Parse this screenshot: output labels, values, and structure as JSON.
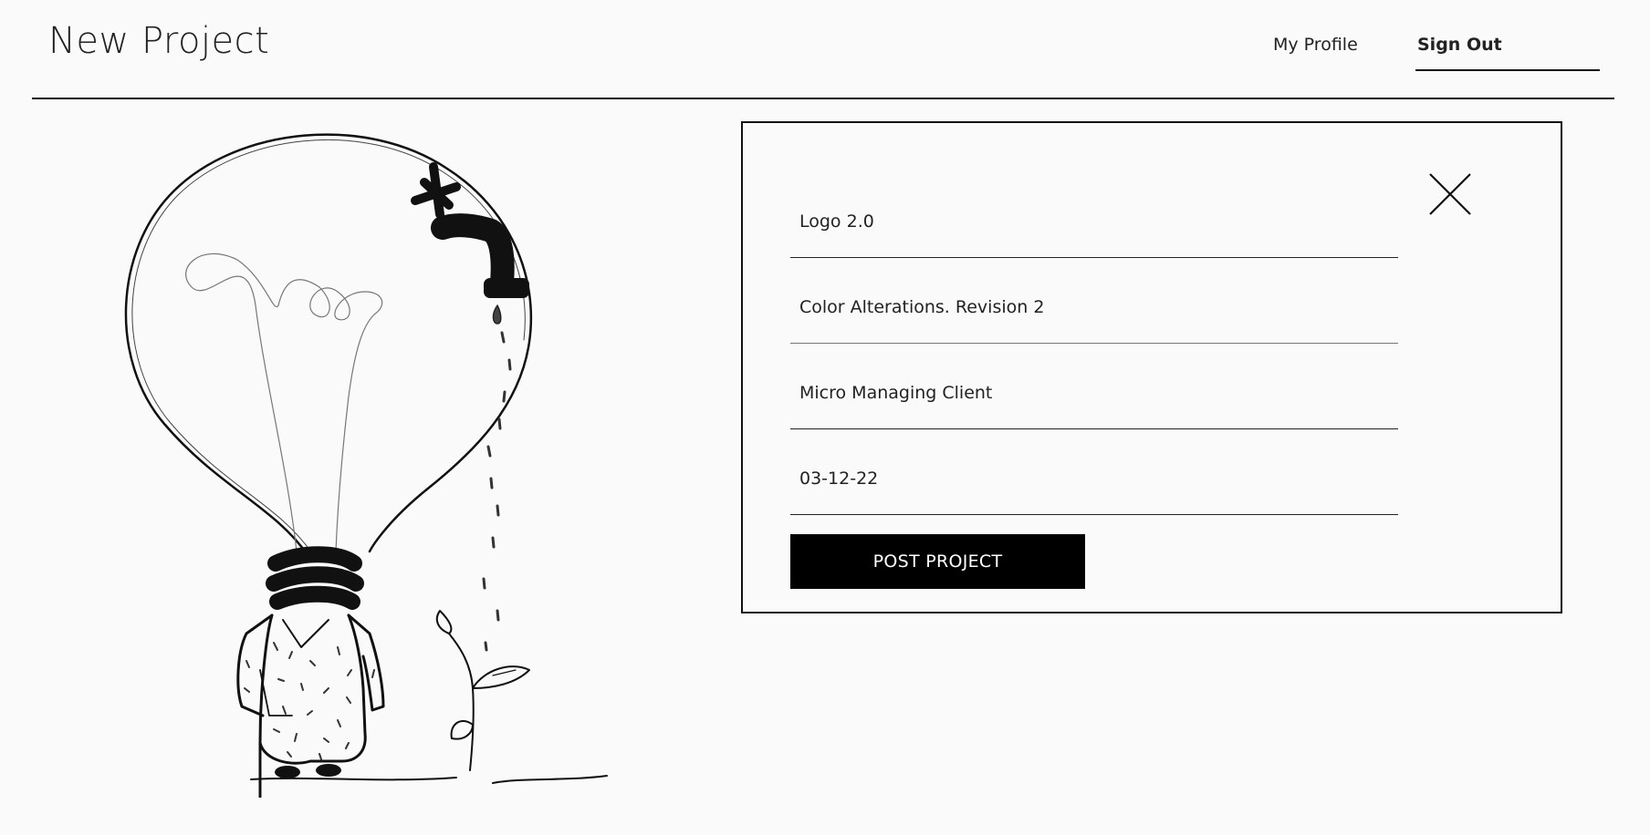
{
  "header": {
    "title": "New Project",
    "nav": {
      "profile_label": "My Profile",
      "signout_label": "Sign Out"
    }
  },
  "illustration": {
    "description_icon": "lightbulb-faucet-illustration"
  },
  "form": {
    "close_icon": "close-icon",
    "fields": [
      {
        "value": "Logo 2.0"
      },
      {
        "value": "Color Alterations. Revision 2"
      },
      {
        "value": "Micro Managing Client"
      },
      {
        "value": "03-12-22"
      }
    ],
    "submit_label": "POST PROJECT"
  },
  "colors": {
    "background": "#fafafa",
    "ink": "#111111",
    "button_bg": "#000000",
    "button_text": "#ffffff"
  }
}
